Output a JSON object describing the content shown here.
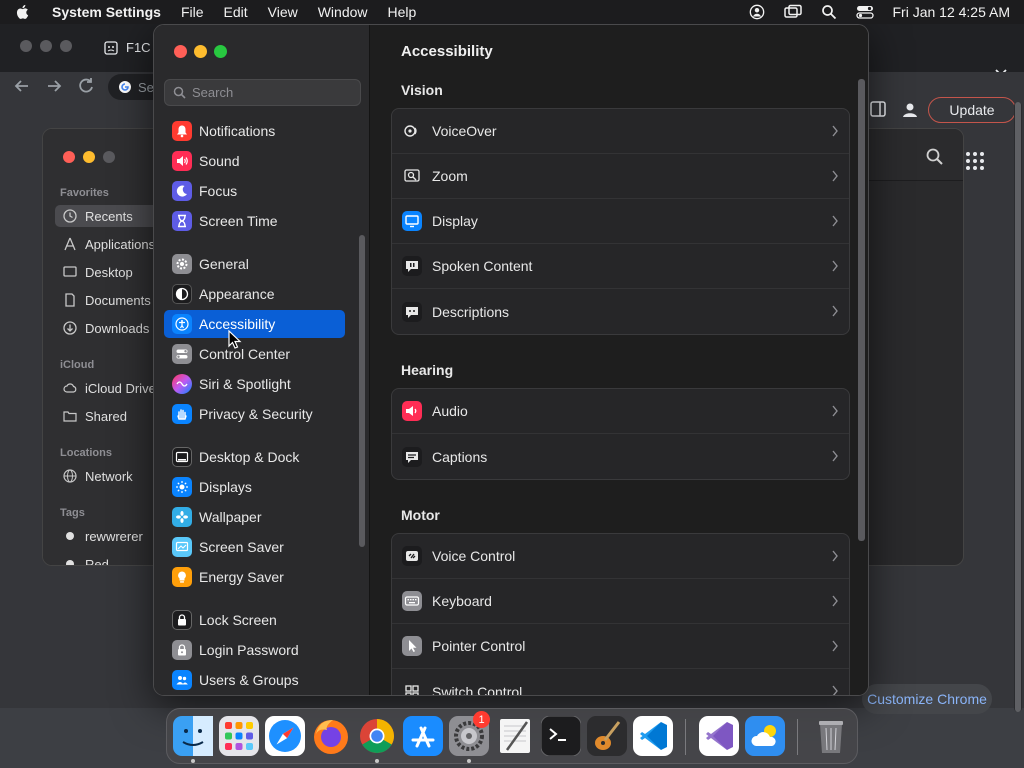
{
  "menubar": {
    "app_name": "System Settings",
    "menus": [
      "File",
      "Edit",
      "View",
      "Window",
      "Help"
    ],
    "clock": "Fri Jan 12  4:25 AM"
  },
  "chrome": {
    "tab_title": "F1C",
    "omnibox_text": "Se",
    "update_label": "Update",
    "customize_label": "Customize Chrome"
  },
  "finder": {
    "sections": {
      "favorites": "Favorites",
      "icloud": "iCloud",
      "locations": "Locations",
      "tags": "Tags"
    },
    "items": {
      "recents": "Recents",
      "applications": "Applications",
      "desktop": "Desktop",
      "documents": "Documents",
      "downloads": "Downloads",
      "icloud_drive": "iCloud Drive",
      "shared": "Shared",
      "network": "Network",
      "tag1": "rewwrerer",
      "tag2": "Red"
    }
  },
  "settings": {
    "search_placeholder": "Search",
    "sidebar": [
      {
        "label": "Notifications",
        "icon": "bell-icon",
        "color": "#ff3b30"
      },
      {
        "label": "Sound",
        "icon": "speaker-icon",
        "color": "#ff2d55"
      },
      {
        "label": "Focus",
        "icon": "moon-icon",
        "color": "#5e5ce6"
      },
      {
        "label": "Screen Time",
        "icon": "hourglass-icon",
        "color": "#5e5ce6"
      },
      {
        "label": "General",
        "icon": "gear-icon",
        "color": "#8e8e93"
      },
      {
        "label": "Appearance",
        "icon": "appearance-icon",
        "color": "#1c1c1e"
      },
      {
        "label": "Accessibility",
        "icon": "accessibility-icon",
        "color": "#0a84ff"
      },
      {
        "label": "Control Center",
        "icon": "toggles-icon",
        "color": "#8e8e93"
      },
      {
        "label": "Siri & Spotlight",
        "icon": "siri-icon",
        "color": "#bf5af2"
      },
      {
        "label": "Privacy & Security",
        "icon": "hand-icon",
        "color": "#0a84ff"
      },
      {
        "label": "Desktop & Dock",
        "icon": "dock-icon",
        "color": "#1c1c1e"
      },
      {
        "label": "Displays",
        "icon": "sun-icon",
        "color": "#0a84ff"
      },
      {
        "label": "Wallpaper",
        "icon": "flower-icon",
        "color": "#32ade6"
      },
      {
        "label": "Screen Saver",
        "icon": "screensaver-icon",
        "color": "#5ac8fa"
      },
      {
        "label": "Energy Saver",
        "icon": "bulb-icon",
        "color": "#ff9f0a"
      },
      {
        "label": "Lock Screen",
        "icon": "lock-icon",
        "color": "#1c1c1e"
      },
      {
        "label": "Login Password",
        "icon": "password-icon",
        "color": "#8e8e93"
      },
      {
        "label": "Users & Groups",
        "icon": "users-icon",
        "color": "#0a84ff"
      }
    ],
    "title": "Accessibility",
    "groups": {
      "vision": {
        "title": "Vision",
        "rows": [
          {
            "label": "VoiceOver",
            "icon": "voiceover-icon"
          },
          {
            "label": "Zoom",
            "icon": "zoom-icon"
          },
          {
            "label": "Display",
            "icon": "display-icon"
          },
          {
            "label": "Spoken Content",
            "icon": "spoken-content-icon"
          },
          {
            "label": "Descriptions",
            "icon": "descriptions-icon"
          }
        ]
      },
      "hearing": {
        "title": "Hearing",
        "rows": [
          {
            "label": "Audio",
            "icon": "audio-icon"
          },
          {
            "label": "Captions",
            "icon": "captions-icon"
          }
        ]
      },
      "motor": {
        "title": "Motor",
        "rows": [
          {
            "label": "Voice Control",
            "icon": "voice-control-icon"
          },
          {
            "label": "Keyboard",
            "icon": "keyboard-icon"
          },
          {
            "label": "Pointer Control",
            "icon": "pointer-control-icon"
          },
          {
            "label": "Switch Control",
            "icon": "switch-control-icon"
          }
        ]
      }
    }
  },
  "dock": {
    "settings_badge": "1"
  }
}
